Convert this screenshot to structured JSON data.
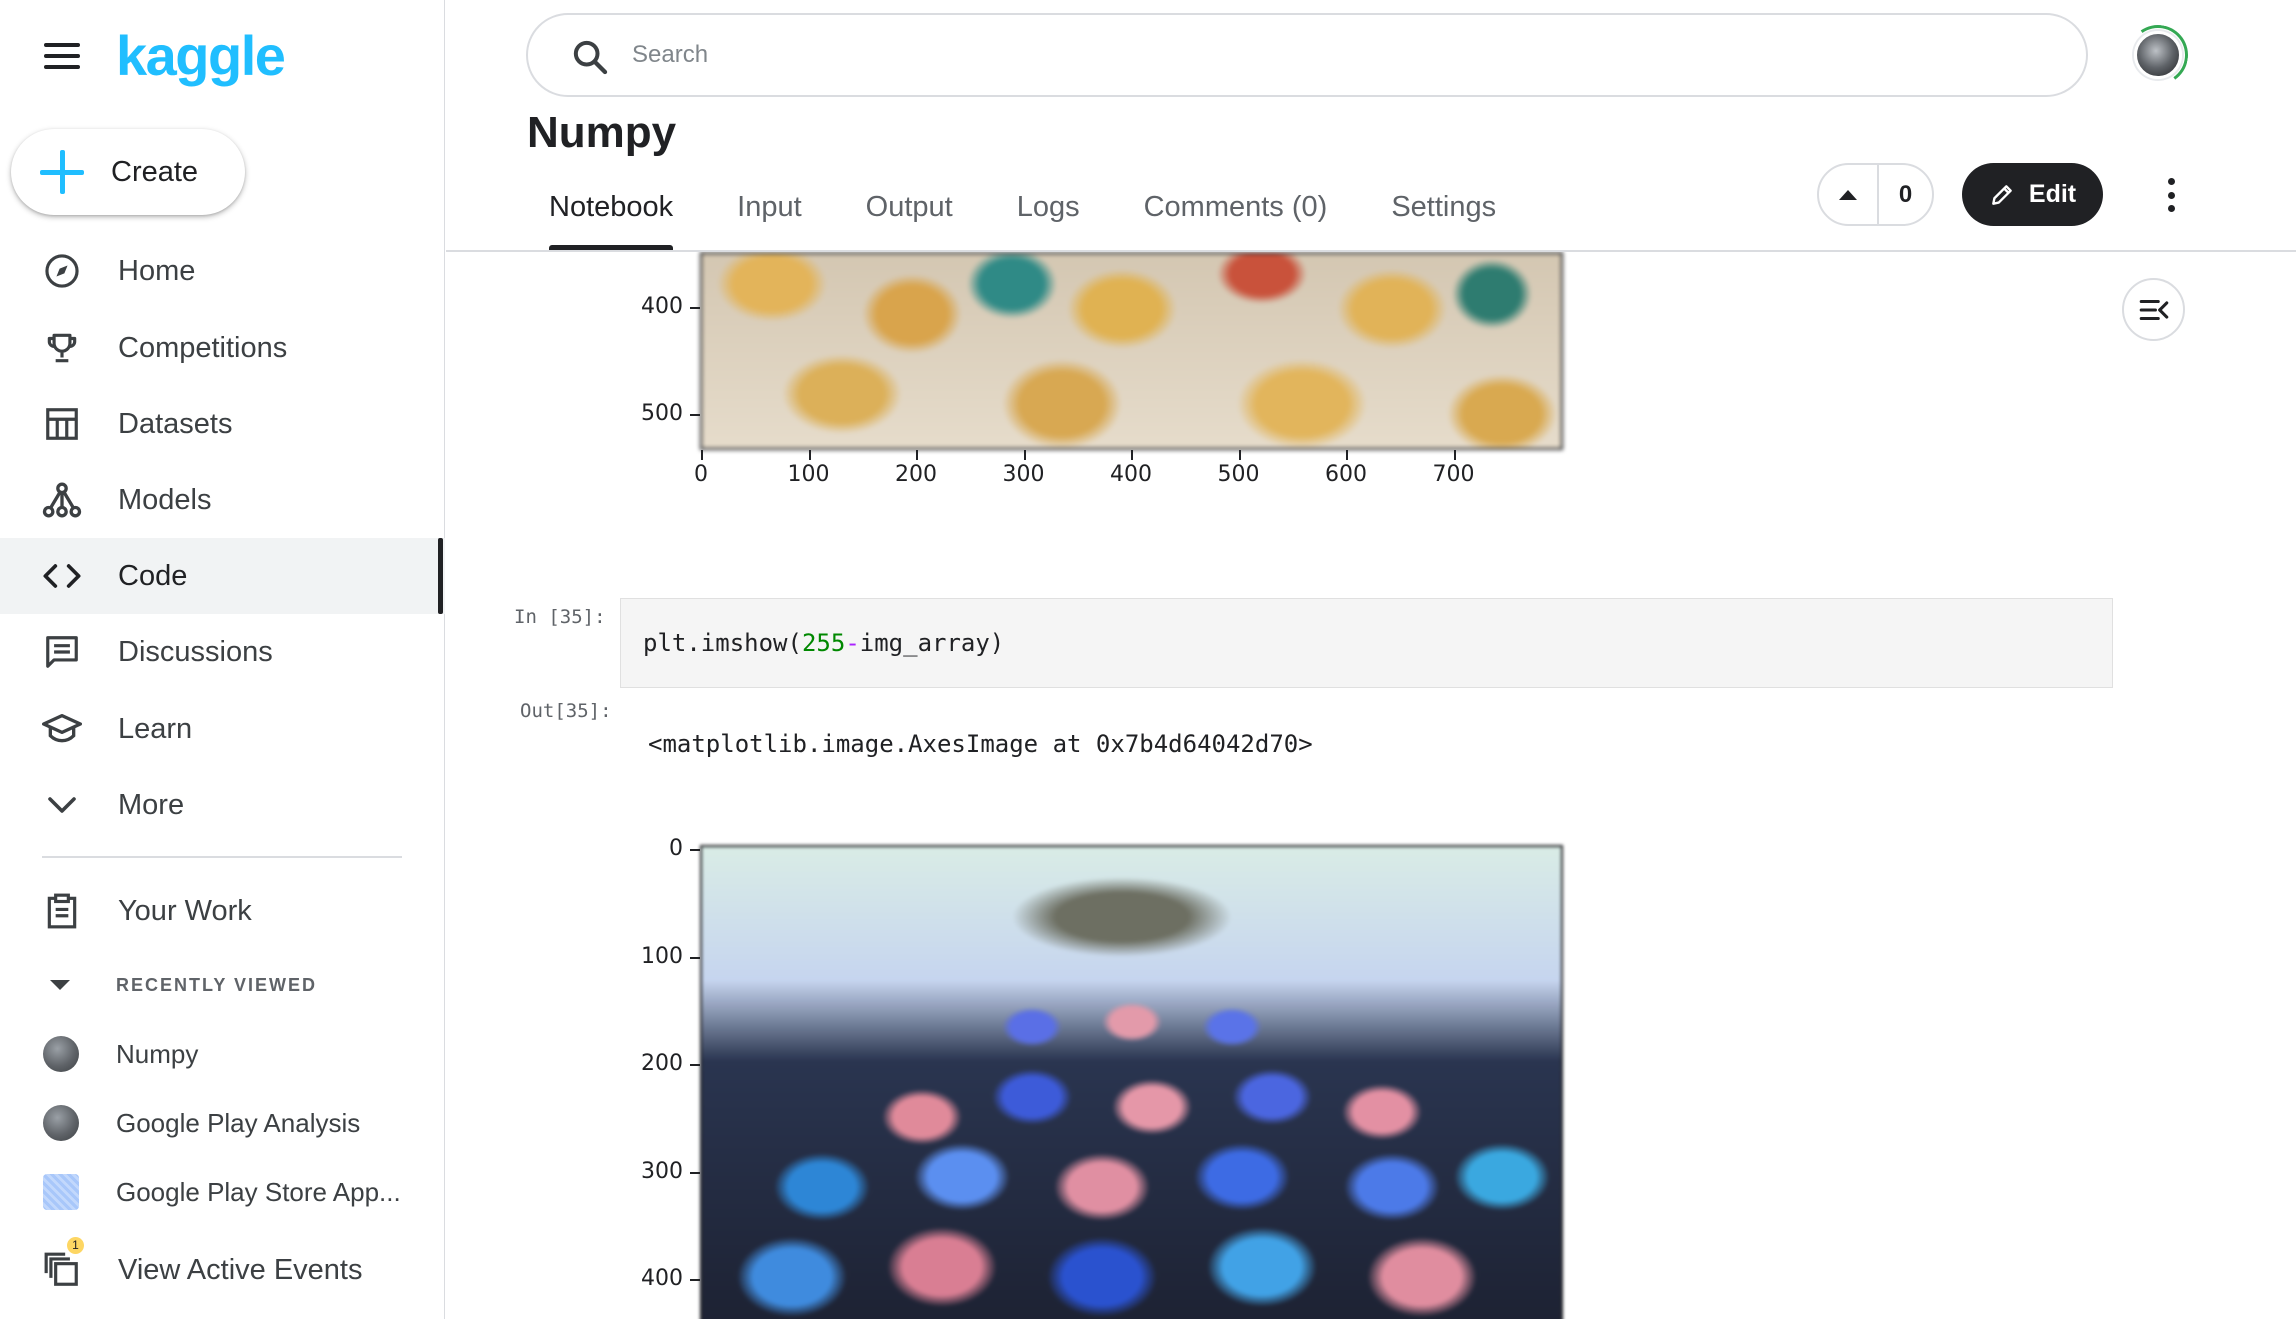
{
  "app": {
    "logo": "kaggle",
    "brand_color": "#20beff"
  },
  "sidebar": {
    "create_label": "Create",
    "nav": [
      {
        "label": "Home",
        "icon": "compass-icon"
      },
      {
        "label": "Competitions",
        "icon": "trophy-icon"
      },
      {
        "label": "Datasets",
        "icon": "table-icon"
      },
      {
        "label": "Models",
        "icon": "models-icon"
      },
      {
        "label": "Code",
        "icon": "code-icon",
        "active": true
      },
      {
        "label": "Discussions",
        "icon": "chat-icon"
      },
      {
        "label": "Learn",
        "icon": "graduation-cap-icon"
      },
      {
        "label": "More",
        "icon": "chevron-down-icon"
      }
    ],
    "your_work": "Your Work",
    "recently_viewed_header": "RECENTLY VIEWED",
    "recent": [
      {
        "label": "Numpy"
      },
      {
        "label": "Google Play Analysis"
      },
      {
        "label": "Google Play Store App..."
      }
    ],
    "view_active_events": "View Active Events",
    "events_badge": "1"
  },
  "header": {
    "search_placeholder": "Search",
    "title": "Numpy",
    "tabs": [
      "Notebook",
      "Input",
      "Output",
      "Logs",
      "Comments (0)",
      "Settings"
    ],
    "active_tab": "Notebook",
    "vote_count": "0",
    "edit_label": "Edit"
  },
  "notebook": {
    "top_plot": {
      "y_ticks": [
        "400",
        "500"
      ],
      "x_ticks": [
        "0",
        "100",
        "200",
        "300",
        "400",
        "500",
        "600",
        "700"
      ]
    },
    "cell_in_prompt": "In [35]:",
    "code": {
      "a": "plt.imshow(",
      "num": "255",
      "op": "-",
      "b": "img_array)"
    },
    "cell_out_prompt": "Out[35]:",
    "output_text": "<matplotlib.image.AxesImage at 0x7b4d64042d70>",
    "bottom_plot": {
      "y_ticks": [
        "0",
        "100",
        "200",
        "300",
        "400"
      ]
    }
  }
}
